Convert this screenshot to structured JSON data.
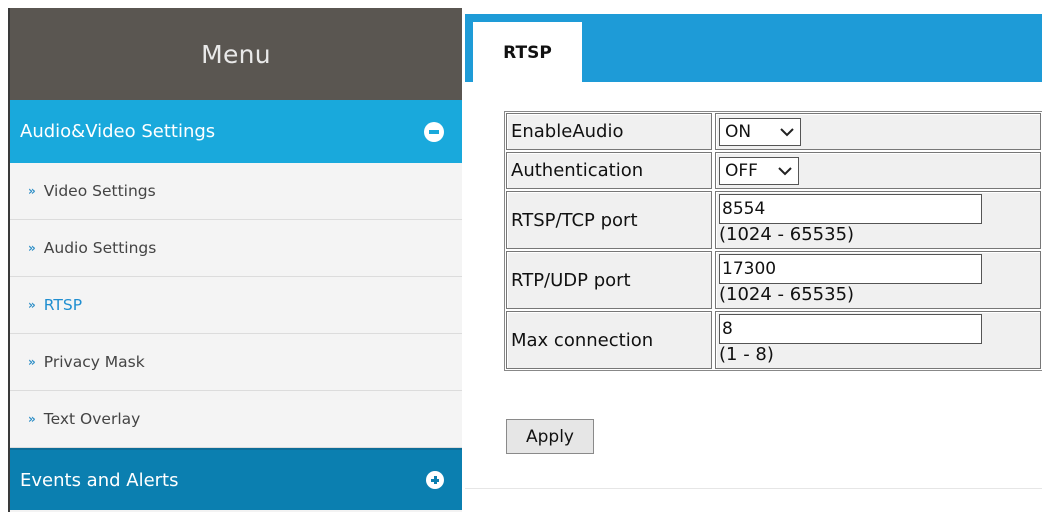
{
  "sidebar": {
    "menu_title": "Menu",
    "sections": [
      {
        "label": "Audio&Video Settings",
        "icon": "minus-circle-icon",
        "expanded": true
      },
      {
        "label": "Events and Alerts",
        "icon": "plus-circle-icon",
        "expanded": false
      }
    ],
    "items": [
      {
        "label": "Video Settings",
        "active": false
      },
      {
        "label": "Audio Settings",
        "active": false
      },
      {
        "label": "RTSP",
        "active": true
      },
      {
        "label": "Privacy Mask",
        "active": false
      },
      {
        "label": "Text Overlay",
        "active": false
      }
    ],
    "chevron_glyph": "»"
  },
  "main": {
    "tab_label": "RTSP",
    "fields": {
      "enable_audio": {
        "label": "EnableAudio",
        "value": "ON"
      },
      "authentication": {
        "label": "Authentication",
        "value": "OFF"
      },
      "rtsp_tcp_port": {
        "label": "RTSP/TCP port",
        "value": "8554",
        "range": "(1024 - 65535)"
      },
      "rtp_udp_port": {
        "label": "RTP/UDP port",
        "value": "17300",
        "range": "(1024 - 65535)"
      },
      "max_connection": {
        "label": "Max connection",
        "value": "8",
        "range": "(1 - 8)"
      }
    },
    "apply_label": "Apply"
  },
  "colors": {
    "menu_header_bg": "#5a5651",
    "section_active_bg": "#19a9dc",
    "section_collapsed_bg": "#0b7fb0",
    "topbar_bg": "#1e9bd7",
    "active_item_text": "#1f8ed0"
  }
}
